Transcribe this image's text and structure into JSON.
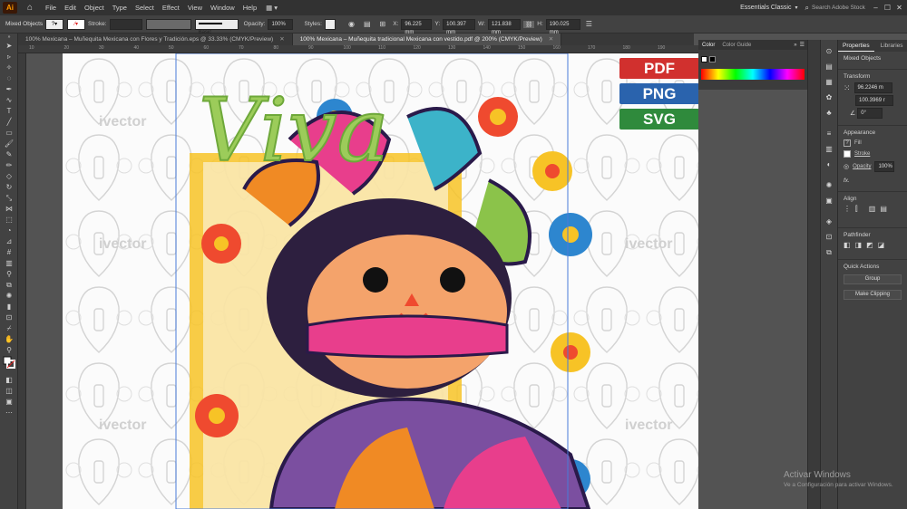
{
  "menubar": {
    "logo": "Ai",
    "items": [
      "File",
      "Edit",
      "Object",
      "Type",
      "Select",
      "Effect",
      "View",
      "Window",
      "Help"
    ],
    "workspace": "Essentials Classic",
    "search_placeholder": "Search Adobe Stock"
  },
  "controlbar": {
    "selection": "Mixed Objects",
    "stroke_label": "Stroke:",
    "brush": "Basic",
    "opacity_label": "Opacity:",
    "opacity_value": "100%",
    "styles_label": "Styles:",
    "x_label": "X:",
    "x_value": "96.225 mm",
    "y_label": "Y:",
    "y_value": "100.397 mm",
    "w_label": "W:",
    "w_value": "121.838 mm",
    "h_label": "H:",
    "h_value": "190.025 mm"
  },
  "tabs": [
    {
      "label": "100% Mexicana – Muñequita Mexicana con Flores y Tradición.eps @ 33.33% (CMYK/Preview)"
    },
    {
      "label": "100% Mexicana – Muñequita tradicional Mexicana con vestido.pdf @ 200% (CMYK/Preview)"
    }
  ],
  "ruler_ticks": [
    "10",
    "20",
    "30",
    "40",
    "50",
    "60",
    "70",
    "80",
    "90",
    "100",
    "110",
    "120",
    "130",
    "140",
    "150",
    "160",
    "170",
    "180",
    "190"
  ],
  "artwork": {
    "title": "Viva",
    "watermark": "ivector",
    "formats": [
      {
        "label": "PDF",
        "color": "#d1302e"
      },
      {
        "label": "PNG",
        "color": "#2a63ad"
      },
      {
        "label": "SVG",
        "color": "#2f8a3c"
      }
    ]
  },
  "color_panel": {
    "tab1": "Color",
    "tab2": "Color Guide"
  },
  "properties": {
    "tab1": "Properties",
    "tab2": "Libraries",
    "selection": "Mixed Objects",
    "transform_label": "Transform",
    "x_value": "96.2246 m",
    "y_value": "100.3969 r",
    "rotate_value": "0°",
    "appearance_label": "Appearance",
    "fill_label": "Fill",
    "stroke_label": "Stroke",
    "opacity_label": "Opacity",
    "opacity_value": "100%",
    "fx_label": "fx.",
    "align_label": "Align",
    "pathfinder_label": "Pathfinder",
    "quick_actions_label": "Quick Actions",
    "group_button": "Group",
    "clipping_button": "Make Clipping"
  },
  "os_watermark": {
    "line1": "Activar Windows",
    "line2": "Ve a Configuración para activar Windows."
  }
}
